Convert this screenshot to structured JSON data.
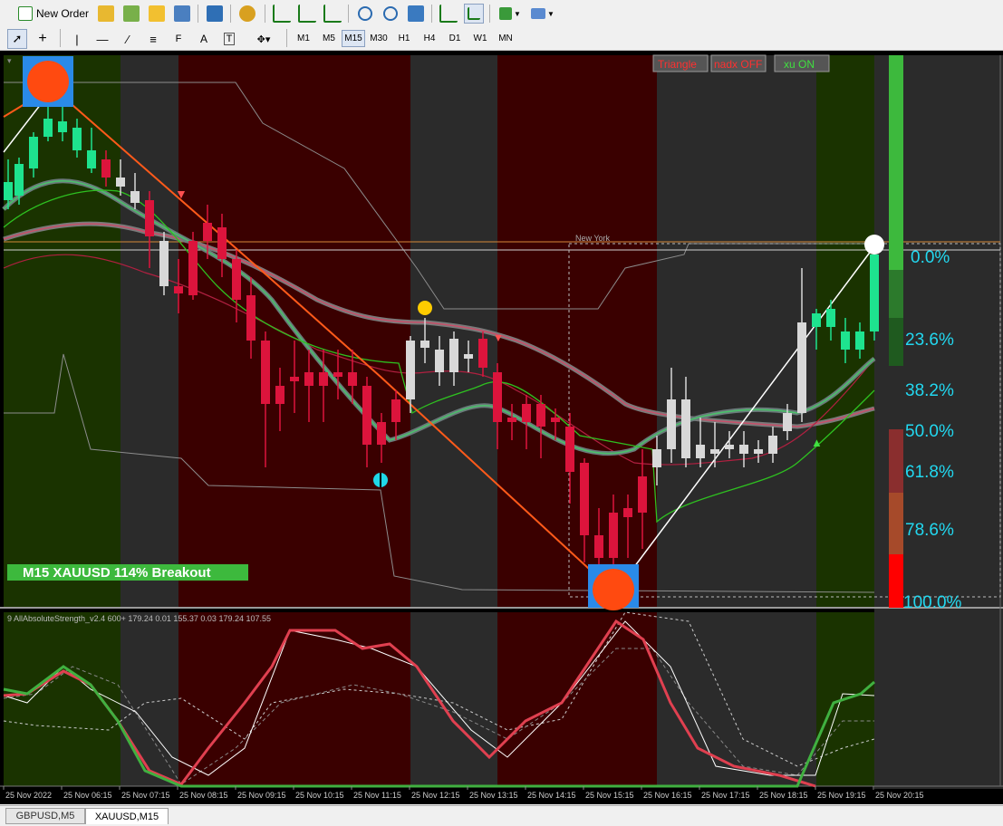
{
  "toolbar": {
    "new_order_label": "New Order",
    "timeframes": [
      "M1",
      "M5",
      "M15",
      "M30",
      "H1",
      "H4",
      "D1",
      "W1",
      "MN"
    ],
    "active_timeframe": "M15"
  },
  "chart": {
    "buttons": {
      "triangle": "Triangle",
      "nadx": "nadx OFF",
      "xu": "xu ON"
    },
    "session_label": "New York",
    "breakout_banner": "M15 XAUUSD 114% Breakout",
    "fib_levels": [
      "0.0%",
      "23.6%",
      "38.2%",
      "50.0%",
      "61.8%",
      "78.6%",
      "100.0%"
    ],
    "indicator_label": "9 AllAbsoluteStrength_v2.4 600+ 179.24 0.01 155.37 0.03 179.24 107.55",
    "time_labels": [
      "25 Nov 2022",
      "25 Nov 06:15",
      "25 Nov 07:15",
      "25 Nov 08:15",
      "25 Nov 09:15",
      "25 Nov 10:15",
      "25 Nov 11:15",
      "25 Nov 12:15",
      "25 Nov 13:15",
      "25 Nov 14:15",
      "25 Nov 15:15",
      "25 Nov 16:15",
      "25 Nov 17:15",
      "25 Nov 18:15",
      "25 Nov 19:15",
      "25 Nov 20:15"
    ],
    "colors": {
      "bull_candle": "#1ee38f",
      "bear_candle": "#dc143c",
      "neutral_candle": "#d8d8d8",
      "bear_zone": "#3a0000",
      "bull_zone": "#1a3300",
      "neutral_zone": "#2b2b2b"
    }
  },
  "tabs": [
    "GBPUSD,M5",
    "XAUUSD,M15"
  ],
  "active_tab": "XAUUSD,M15"
}
